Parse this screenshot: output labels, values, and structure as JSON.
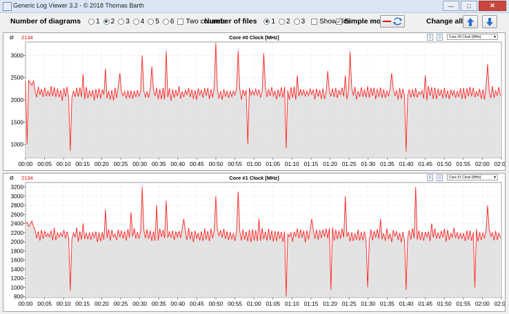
{
  "window": {
    "title": "Generic Log Viewer 3.2 - © 2018 Thomas Barth"
  },
  "toolbar": {
    "diagrams_label": "Number of diagrams",
    "diagram_options": [
      "1",
      "2",
      "3",
      "4",
      "5",
      "6"
    ],
    "diagrams_selected": "2",
    "two_columns_label": "Two columns",
    "files_label": "Number of files",
    "file_options": [
      "1",
      "2",
      "3"
    ],
    "files_selected": "1",
    "show_files_label": "Show files",
    "simple_mode_label": "Simple mode",
    "simple_mode_checked": true,
    "change_all_label": "Change all"
  },
  "colors": {
    "line": "#ff2020",
    "fill": "#dedede",
    "panel": "#ffffff",
    "grid": "#c8c8c8"
  },
  "chart_data": [
    {
      "type": "line",
      "title": "Core #0 Clock [MHz]",
      "selector": "Core #0 Clock [MHz]",
      "avg_symbol": "Ø",
      "avg_value": "2134",
      "yticks": [
        1000,
        1500,
        2000,
        2500,
        3000
      ],
      "ylim": [
        700,
        3300
      ],
      "xticks": [
        "00:00",
        "00:05",
        "00:10",
        "00:15",
        "00:20",
        "00:25",
        "00:30",
        "00:35",
        "00:40",
        "00:45",
        "00:50",
        "00:55",
        "01:00",
        "01:05",
        "01:10",
        "01:15",
        "01:20",
        "01:25",
        "01:30",
        "01:35",
        "01:40",
        "01:45",
        "01:50",
        "01:55",
        "02:00",
        "02:05"
      ],
      "xlim_minutes": [
        0,
        125
      ],
      "baseline": 2150,
      "start_level": 2380,
      "start_until_minutes": 2.5,
      "spikes": [
        {
          "x": 0.4,
          "y": 1000
        },
        {
          "x": 11.8,
          "y": 850
        },
        {
          "x": 15.0,
          "y": 2580
        },
        {
          "x": 21.2,
          "y": 2700
        },
        {
          "x": 24.8,
          "y": 2600
        },
        {
          "x": 30.7,
          "y": 3000
        },
        {
          "x": 33.2,
          "y": 2750
        },
        {
          "x": 36.8,
          "y": 3100
        },
        {
          "x": 49.8,
          "y": 3280
        },
        {
          "x": 55.8,
          "y": 3100
        },
        {
          "x": 58.3,
          "y": 1010
        },
        {
          "x": 62.4,
          "y": 3050
        },
        {
          "x": 68.5,
          "y": 910
        },
        {
          "x": 71.2,
          "y": 2550
        },
        {
          "x": 79.2,
          "y": 2650
        },
        {
          "x": 84.2,
          "y": 2550
        },
        {
          "x": 85.3,
          "y": 3080
        },
        {
          "x": 96.2,
          "y": 2600
        },
        {
          "x": 99.8,
          "y": 830
        },
        {
          "x": 105.1,
          "y": 2550
        },
        {
          "x": 121.2,
          "y": 2800
        }
      ]
    },
    {
      "type": "line",
      "title": "Core #1 Clock [MHz]",
      "selector": "Core #1 Clock [MHz]",
      "avg_symbol": "Ø",
      "avg_value": "2134",
      "yticks": [
        800,
        1000,
        1200,
        1400,
        1600,
        1800,
        2000,
        2200,
        2400,
        2600,
        2800,
        3000,
        3200
      ],
      "ylim": [
        780,
        3300
      ],
      "xticks": [
        "00:00",
        "00:05",
        "00:10",
        "00:15",
        "00:20",
        "00:25",
        "00:30",
        "00:35",
        "00:40",
        "00:45",
        "00:50",
        "00:55",
        "01:00",
        "01:05",
        "01:10",
        "01:15",
        "01:20",
        "01:25",
        "01:30",
        "01:35",
        "01:40",
        "01:45",
        "01:50",
        "01:55",
        "02:00",
        "02:05"
      ],
      "xlim_minutes": [
        0,
        125
      ],
      "baseline": 2150,
      "start_level": 2400,
      "start_until_minutes": 2.5,
      "spikes": [
        {
          "x": 11.8,
          "y": 930
        },
        {
          "x": 15.0,
          "y": 2400
        },
        {
          "x": 21.2,
          "y": 2700
        },
        {
          "x": 27.6,
          "y": 2650
        },
        {
          "x": 30.7,
          "y": 3200
        },
        {
          "x": 34.3,
          "y": 2800
        },
        {
          "x": 36.8,
          "y": 2900
        },
        {
          "x": 41.5,
          "y": 2500
        },
        {
          "x": 49.8,
          "y": 3000
        },
        {
          "x": 55.8,
          "y": 3100
        },
        {
          "x": 61.3,
          "y": 2500
        },
        {
          "x": 68.5,
          "y": 800
        },
        {
          "x": 75.0,
          "y": 2500
        },
        {
          "x": 80.2,
          "y": 940
        },
        {
          "x": 84.2,
          "y": 3000
        },
        {
          "x": 89.9,
          "y": 1000
        },
        {
          "x": 93.2,
          "y": 2500
        },
        {
          "x": 99.8,
          "y": 940
        },
        {
          "x": 102.5,
          "y": 3200
        },
        {
          "x": 106.8,
          "y": 2400
        },
        {
          "x": 118.2,
          "y": 1000
        },
        {
          "x": 121.2,
          "y": 2800
        }
      ]
    }
  ]
}
